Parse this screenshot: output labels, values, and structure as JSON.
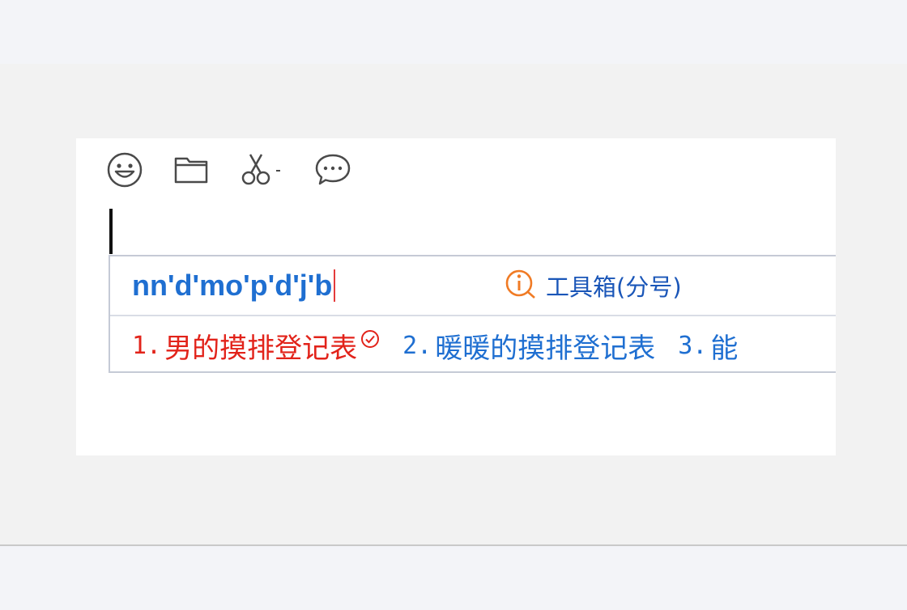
{
  "ime": {
    "pinyin": "nn'd'mo'p'd'j'b",
    "toolbox_label": "工具箱(分号)",
    "candidates": [
      {
        "index": "1.",
        "text": "男的摸排登记表"
      },
      {
        "index": "2.",
        "text": "暖暖的摸排登记表"
      },
      {
        "index": "3.",
        "text": "能"
      }
    ],
    "colors": {
      "pinyin": "#1f6fd1",
      "selected_candidate": "#e2231a",
      "candidate": "#1f6fd1",
      "toolbox_icon": "#f07b25"
    }
  },
  "toolbar": {
    "icons": [
      "emoji-icon",
      "folder-icon",
      "scissors-icon",
      "chat-bubble-icon"
    ]
  }
}
